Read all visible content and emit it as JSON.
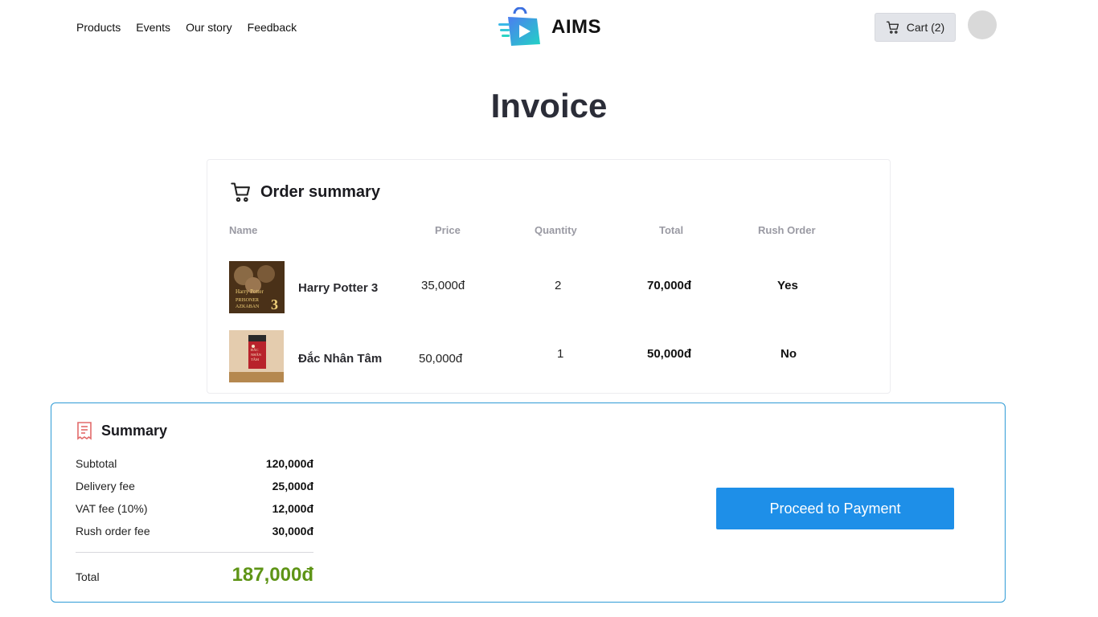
{
  "nav": {
    "items": [
      "Products",
      "Events",
      "Our story",
      "Feedback"
    ]
  },
  "brand": {
    "name": "AIMS"
  },
  "cart": {
    "label": "Cart (2)"
  },
  "page": {
    "title": "Invoice"
  },
  "order_summary": {
    "title": "Order summary",
    "columns": [
      "Name",
      "Price",
      "Quantity",
      "Total",
      "Rush Order"
    ],
    "rows": [
      {
        "name": "Harry Potter 3",
        "price": "35,000đ",
        "quantity": "2",
        "total": "70,000đ",
        "rush": "Yes",
        "cover_text": "Harry Potter PRISONER AZKABAN 3"
      },
      {
        "name": "Đắc Nhân Tâm",
        "price": "50,000đ",
        "quantity": "1",
        "total": "50,000đ",
        "rush": "No",
        "cover_text": "ĐẮC NHÂN TÂM"
      }
    ]
  },
  "summary": {
    "title": "Summary",
    "lines": [
      {
        "label": "Subtotal",
        "value": "120,000đ"
      },
      {
        "label": "Delivery fee",
        "value": "25,000đ"
      },
      {
        "label": "VAT fee (10%)",
        "value": "12,000đ"
      },
      {
        "label": "Rush order fee",
        "value": "30,000đ"
      }
    ],
    "total_label": "Total",
    "total_value": "187,000đ",
    "pay_button": "Proceed to Payment"
  },
  "colors": {
    "accent": "#1e8fe8",
    "summary_border": "#2f9bd6",
    "total_green": "#5e9416",
    "receipt_icon": "#e26a6a"
  },
  "icons": {
    "cart": "cart-icon",
    "order": "shopping-cart-icon",
    "summary": "receipt-icon",
    "logo": "shopping-bag-logo-icon"
  }
}
